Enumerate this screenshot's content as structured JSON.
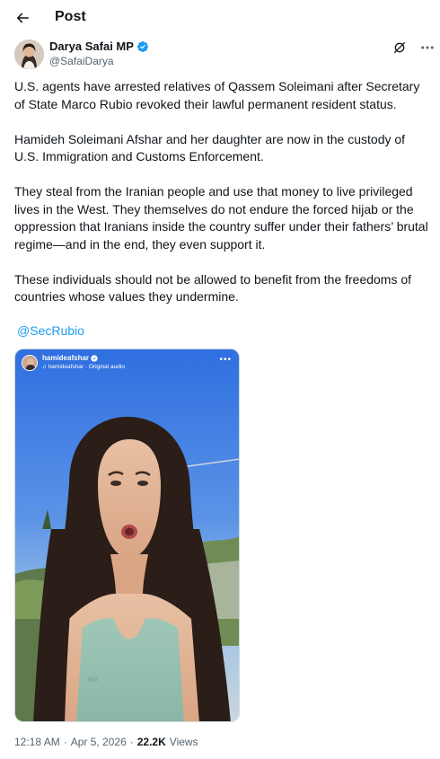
{
  "header": {
    "title": "Post"
  },
  "author": {
    "name": "Darya Safai MP",
    "handle": "@SafaiDarya"
  },
  "tweet": {
    "paragraphs": [
      "U.S. agents have arrested relatives of Qassem Soleimani after Secretary of State Marco Rubio revoked their lawful permanent resident status.",
      "Hamideh Soleimani Afshar and her daughter are now in the custody of U.S. Immigration and Customs Enforcement.",
      "They steal from the Iranian people and use that money to live privileged lives in the West. They themselves do not endure the forced hijab or the oppression that Iranians inside the country suffer under their fathers’ brutal regime—and in the end, they even support it.",
      "These individuals should not be allowed to benefit from the freedoms of countries whose values they undermine."
    ],
    "mention": "@SecRubio"
  },
  "media": {
    "username": "hamideafshar",
    "audio": "hamideafshar · Original audio",
    "logo_text": "alo"
  },
  "meta": {
    "time": "12:18 AM",
    "separator1": "·",
    "date": "Apr 5, 2026",
    "separator2": "·",
    "views_count": "22.2K",
    "views_label": "Views"
  },
  "colors": {
    "accent": "#1d9bf0",
    "text": "#0f1419",
    "secondary": "#536471"
  },
  "icons": {
    "back": "arrow-left-icon",
    "verified": "verified-badge-icon",
    "grok": "grok-icon",
    "more": "more-icon",
    "audio": "music-note-icon"
  }
}
